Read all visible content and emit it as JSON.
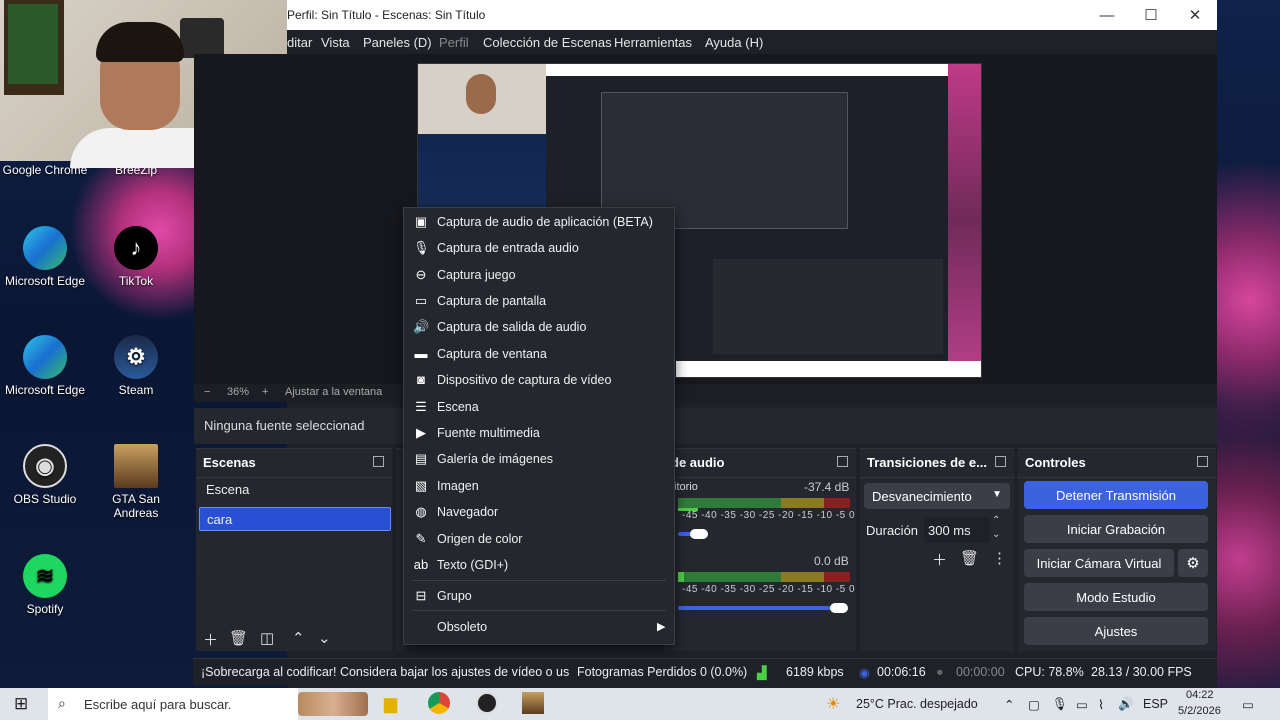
{
  "desktop": {
    "icons": [
      {
        "label": "Google Chrome"
      },
      {
        "label": "BreeZip"
      },
      {
        "label": "Microsoft Edge"
      },
      {
        "label": "TikTok"
      },
      {
        "label": "Microsoft Edge"
      },
      {
        "label": "Steam"
      },
      {
        "label": "OBS Studio"
      },
      {
        "label": "GTA San Andreas"
      },
      {
        "label": "Spotify"
      }
    ]
  },
  "obs": {
    "title": "Perfil: Sin Título - Escenas: Sin Título",
    "menu": [
      "ditar",
      "Vista",
      "Paneles (D)",
      "Perfil",
      "Colección de Escenas",
      "Herramientas",
      "Ayuda (H)"
    ],
    "zoom": {
      "minus": "−",
      "percent": "36%",
      "plus": "+",
      "fit": "Ajustar a la ventana"
    },
    "source_bar": "Ninguna fuente seleccionad",
    "scenes": {
      "title": "Escenas",
      "items": [
        "Escena",
        "cara"
      ],
      "selected": "cara"
    },
    "audio": {
      "title": "de audio",
      "ch1": {
        "name": "itorio",
        "db": "-37.4 dB"
      },
      "ch2": {
        "db": "0.0 dB"
      },
      "ticks": "-45 -40 -35 -30 -25 -20 -15 -10 -5 0"
    },
    "transitions": {
      "title": "Transiciones de e...",
      "type": "Desvanecimiento",
      "duration_label": "Duración",
      "duration_value": "300 ms"
    },
    "controls": {
      "title": "Controles",
      "stop_stream": "Detener Transmisión",
      "start_recording": "Iniciar Grabación",
      "start_virtual_cam": "Iniciar Cámara Virtual",
      "studio_mode": "Modo Estudio",
      "settings": "Ajustes"
    },
    "status": {
      "warning": "¡Sobrecarga al codificar! Considera bajar los ajustes de vídeo o us",
      "dropped": "Fotogramas Perdidos 0 (0.0%)",
      "bitrate": "6189 kbps",
      "stream_time": "00:06:16",
      "rec_time": "00:00:00",
      "cpu": "CPU: 78.8%",
      "fps": "28.13 / 30.00 FPS"
    }
  },
  "context_menu": {
    "items": [
      {
        "label": "Captura de audio de aplicación (BETA)",
        "icon": "app-audio-icon"
      },
      {
        "label": "Captura de entrada audio",
        "icon": "microphone-icon"
      },
      {
        "label": "Captura juego",
        "icon": "gamepad-icon"
      },
      {
        "label": "Captura de pantalla",
        "icon": "monitor-icon"
      },
      {
        "label": "Captura de salida de audio",
        "icon": "speaker-icon"
      },
      {
        "label": "Captura de ventana",
        "icon": "window-icon"
      },
      {
        "label": "Dispositivo de captura de vídeo",
        "icon": "camera-icon"
      },
      {
        "label": "Escena",
        "icon": "list-icon"
      },
      {
        "label": "Fuente multimedia",
        "icon": "play-icon"
      },
      {
        "label": "Galería de imágenes",
        "icon": "slideshow-icon"
      },
      {
        "label": "Imagen",
        "icon": "image-icon"
      },
      {
        "label": "Navegador",
        "icon": "globe-icon"
      },
      {
        "label": "Origen de color",
        "icon": "brush-icon"
      },
      {
        "label": "Texto (GDI+)",
        "icon": "text-icon"
      },
      {
        "label": "Grupo",
        "icon": "group-icon"
      },
      {
        "label": "Obsoleto",
        "icon": "chevron-right-icon"
      }
    ]
  },
  "taskbar": {
    "search_placeholder": "Escribe aquí para buscar.",
    "weather": "25°C  Prac. despejado",
    "lang": "ESP",
    "time": "04:22",
    "date": "5/2/2026"
  },
  "colors": {
    "accent": "#3c62e0",
    "panel": "#25272e",
    "background": "#1f2128"
  }
}
